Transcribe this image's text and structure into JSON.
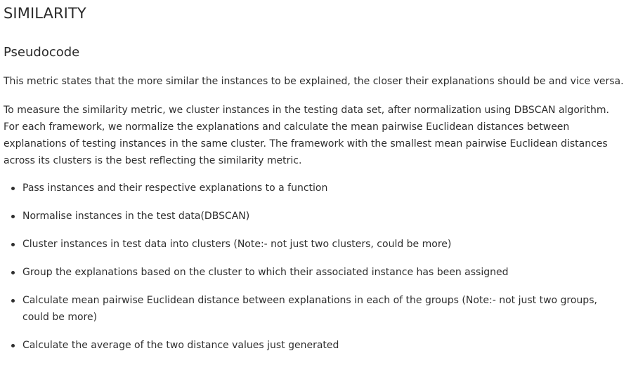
{
  "heading": "SIMILARITY",
  "subheading": "Pseudocode",
  "paragraphs": [
    "This metric states that the more similar the instances to be explained, the closer their explanations should be and vice versa.",
    "To measure the similarity metric, we cluster instances in the testing data set, after normalization using DBSCAN algorithm. For each framework, we normalize the explanations and calculate the mean pairwise Euclidean distances between explanations of testing instances in the same cluster. The framework with the smallest mean pairwise Euclidean distances across its clusters is the best reflecting the similarity metric."
  ],
  "steps": [
    "Pass instances and their respective explanations to a function",
    "Normalise instances in the test data(DBSCAN)",
    "Cluster instances in test data into clusters (Note:- not just two clusters, could be more)",
    "Group the explanations based on the cluster to which their associated instance has been assigned",
    "Calculate mean pairwise Euclidean distance between explanations in each of the groups (Note:- not just two groups, could be more)",
    "Calculate the average of the two distance values just generated"
  ]
}
